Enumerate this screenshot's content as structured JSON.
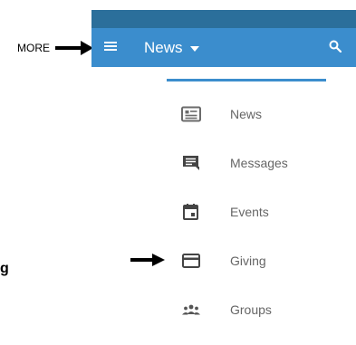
{
  "annotation": {
    "more_label": "MORE"
  },
  "app_bar": {
    "title": "News"
  },
  "menu": {
    "items": [
      {
        "label": "News",
        "icon": "news-icon"
      },
      {
        "label": "Messages",
        "icon": "messages-icon"
      },
      {
        "label": "Events",
        "icon": "events-icon"
      },
      {
        "label": "Giving",
        "icon": "giving-icon"
      },
      {
        "label": "Groups",
        "icon": "groups-icon"
      }
    ]
  },
  "colors": {
    "status_bar": "#2b6f9b",
    "app_bar": "#3b8dcd",
    "menu_text": "#666666",
    "menu_icon": "#6b6b6b"
  },
  "partial_text": "g"
}
